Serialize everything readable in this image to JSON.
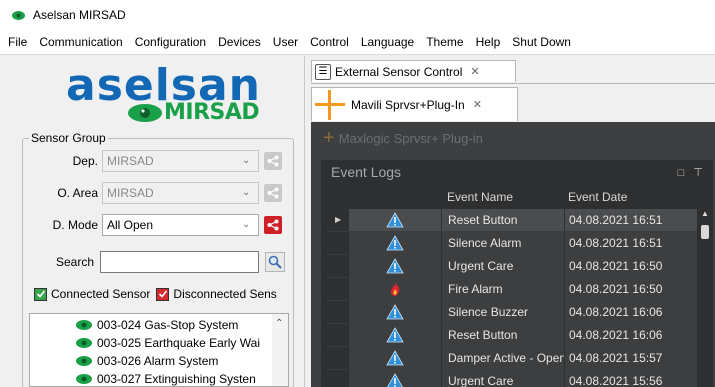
{
  "window": {
    "title": "Aselsan MIRSAD"
  },
  "menu": [
    "File",
    "Communication",
    "Configuration",
    "Devices",
    "User",
    "Control",
    "Language",
    "Theme",
    "Help",
    "Shut Down"
  ],
  "logo": {
    "brand": "aselsan",
    "product": "MIRSAD"
  },
  "sensor_group": {
    "legend": "Sensor Group",
    "dep": {
      "label": "Dep.",
      "value": "MIRSAD"
    },
    "oarea": {
      "label": "O. Area",
      "value": "MIRSAD"
    },
    "dmode": {
      "label": "D. Mode",
      "value": "All Open"
    },
    "search": {
      "label": "Search",
      "value": ""
    },
    "connected": "Connected Sensor",
    "disconnected": "Disconnected Sens"
  },
  "sensors": [
    {
      "label": "003-024  Gas-Stop System"
    },
    {
      "label": "003-025  Earthquake Early Wai"
    },
    {
      "label": "003-026  Alarm System"
    },
    {
      "label": "003-027  Extinguishing Systen"
    }
  ],
  "tabs": {
    "external": "External Sensor Control",
    "mavili": "Mavili Sprvsr+Plug-In",
    "maxlogic": "Maxlogic Sprvsr+ Plug-in"
  },
  "event_logs": {
    "title": "Event Logs",
    "columns": {
      "name": "Event Name",
      "date": "Event Date"
    },
    "rows": [
      {
        "name": "Reset Button",
        "date": "04.08.2021 16:51",
        "icon": "warning-icon"
      },
      {
        "name": "Silence Alarm",
        "date": "04.08.2021 16:51",
        "icon": "warning-icon"
      },
      {
        "name": "Urgent Care",
        "date": "04.08.2021 16:50",
        "icon": "warning-icon"
      },
      {
        "name": "Fire Alarm",
        "date": "04.08.2021 16:50",
        "icon": "fire-icon"
      },
      {
        "name": "Silence Buzzer",
        "date": "04.08.2021 16:06",
        "icon": "warning-icon"
      },
      {
        "name": "Reset Button",
        "date": "04.08.2021 16:06",
        "icon": "warning-icon"
      },
      {
        "name": "Damper Active - Open",
        "date": "04.08.2021 15:57",
        "icon": "warning-icon"
      },
      {
        "name": "Urgent Care",
        "date": "04.08.2021 15:56",
        "icon": "warning-icon"
      }
    ]
  },
  "colors": {
    "brand_blue": "#1268b4",
    "brand_green": "#1aa049",
    "accent_orange": "#f59a1f",
    "alert_red": "#d02027"
  }
}
